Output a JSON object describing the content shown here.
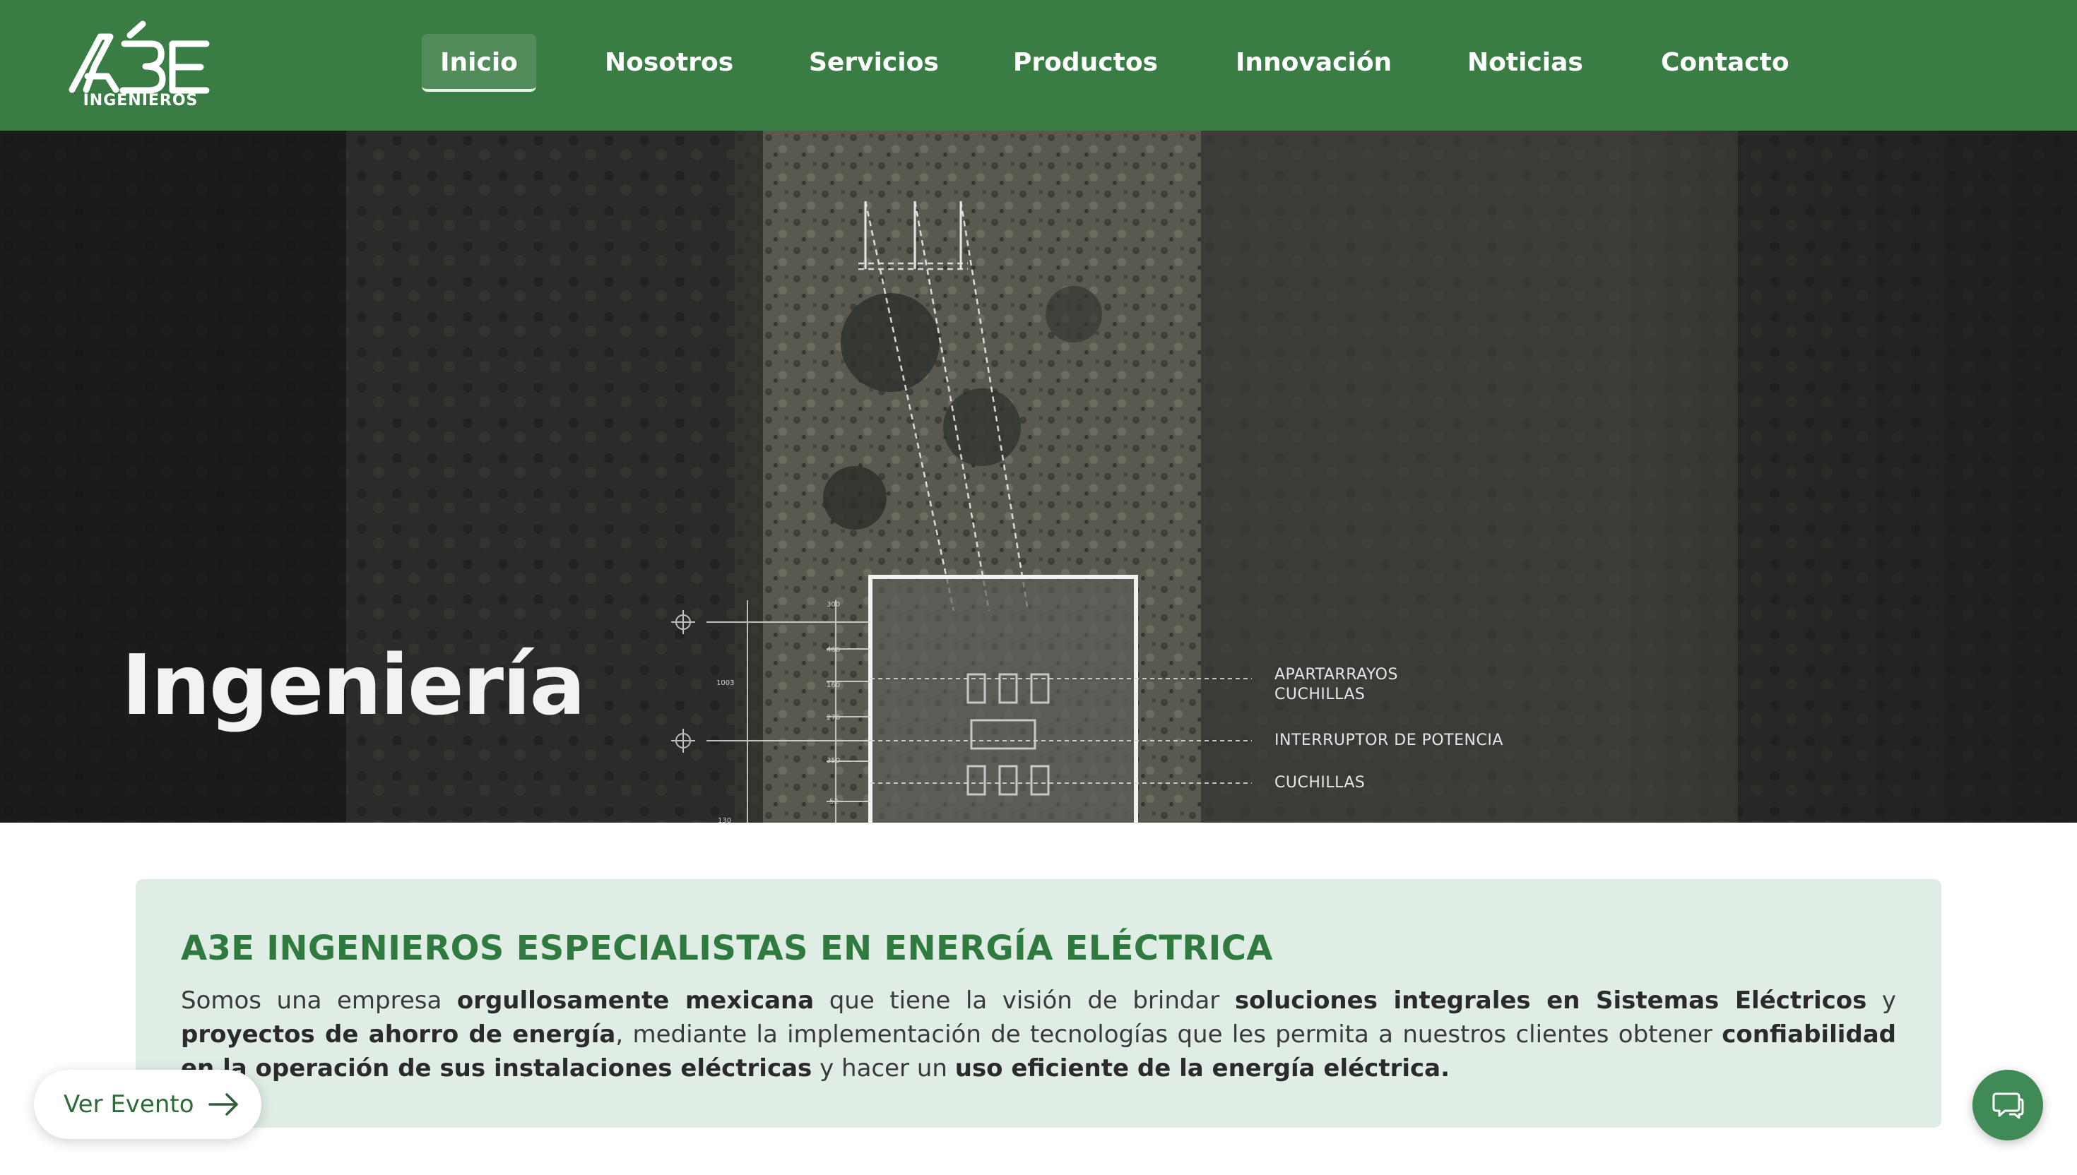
{
  "brand": {
    "logo_text": "A3E",
    "logo_subtext": "INGENIEROS",
    "color_primary": "#3a7d44",
    "color_panel": "#dfede5",
    "color_heading": "#2e7a3f"
  },
  "nav": {
    "items": [
      {
        "label": "Inicio",
        "active": true
      },
      {
        "label": "Nosotros"
      },
      {
        "label": "Servicios"
      },
      {
        "label": "Productos"
      },
      {
        "label": "Innovación"
      },
      {
        "label": "Noticias"
      },
      {
        "label": "Contacto"
      }
    ]
  },
  "hero": {
    "title": "Ingeniería",
    "annotations": {
      "apartarrayos": "APARTARRAYOS",
      "cuchillas_1": "CUCHILLAS",
      "interruptor": "INTERRUPTOR DE POTENCIA",
      "cuchillas_2": "CUCHILLAS"
    },
    "dims": [
      "300",
      "466",
      "1003",
      "160",
      "276",
      "350",
      "52",
      "130"
    ]
  },
  "intro": {
    "heading": "A3E INGENIEROS ESPECIALISTAS EN ENERGÍA ELÉCTRICA",
    "segments": [
      {
        "text": "Somos una empresa "
      },
      {
        "text": "orgullosamente mexicana",
        "bold": true
      },
      {
        "text": " que tiene la visión de brindar "
      },
      {
        "text": "soluciones integrales en Sistemas Eléctricos",
        "bold": true
      },
      {
        "text": " y "
      },
      {
        "text": "proyectos de ahorro de energía",
        "bold": true
      },
      {
        "text": ", mediante la implementación de tecnologías que les permita a nuestros clientes obtener "
      },
      {
        "text": "confiabilidad en la operación de sus instalaciones eléctricas",
        "bold": true
      },
      {
        "text": " y hacer un "
      },
      {
        "text": "uso eficiente de la energía eléctrica.",
        "bold": true
      }
    ]
  },
  "floating": {
    "event_label": "Ver Evento",
    "event_icon": "arrow-right-icon",
    "chat_icon": "chat-bubbles-icon"
  }
}
